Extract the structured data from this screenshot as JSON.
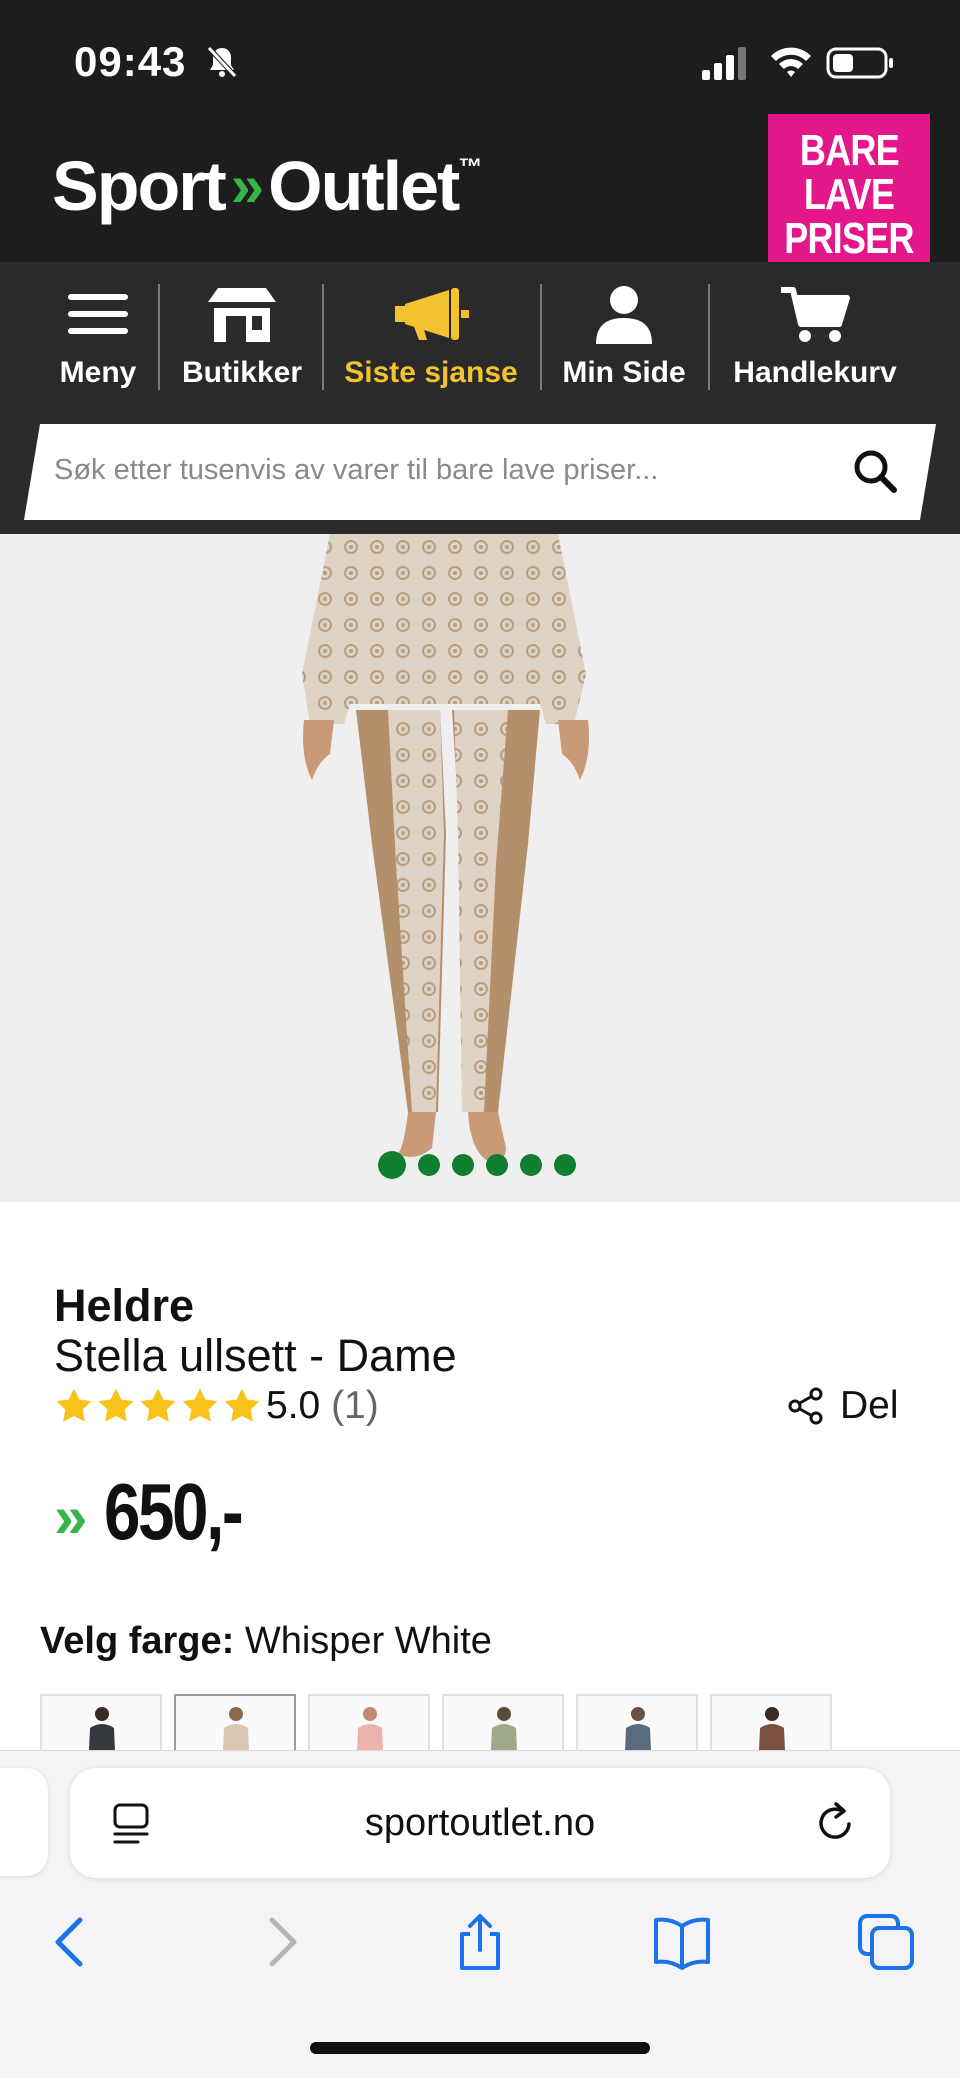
{
  "status": {
    "time": "09:43"
  },
  "header": {
    "logo_left": "Sport",
    "logo_right": "Outlet",
    "logo_tm": "™",
    "badge_lines": [
      "BARE",
      "LAVE",
      "PRISER"
    ]
  },
  "nav": {
    "items": [
      {
        "label": "Meny",
        "icon": "menu-icon"
      },
      {
        "label": "Butikker",
        "icon": "store-icon"
      },
      {
        "label": "Siste sjanse",
        "icon": "megaphone-icon",
        "color": "#f2c230"
      },
      {
        "label": "Min Side",
        "icon": "user-icon"
      },
      {
        "label": "Handlekurv",
        "icon": "cart-icon"
      }
    ]
  },
  "search": {
    "placeholder": "Søk etter tusenvis av varer til bare lave priser..."
  },
  "gallery": {
    "dot_count": 6,
    "active_index": 0,
    "dot_color": "#0f7f2f"
  },
  "product": {
    "brand": "Heldre",
    "name": "Stella ullsett - Dame",
    "rating_value": "5.0",
    "rating_count": "(1)",
    "stars": 5,
    "share_label": "Del",
    "price": "650,-",
    "color_label": "Velg farge:",
    "color_value": "Whisper White",
    "swatch_count": 6,
    "selected_swatch": 1
  },
  "browser": {
    "url": "sportoutlet.no"
  },
  "colors": {
    "brand_green": "#35b449",
    "badge_pink": "#e3178a",
    "star_yellow": "#f7c31b"
  }
}
